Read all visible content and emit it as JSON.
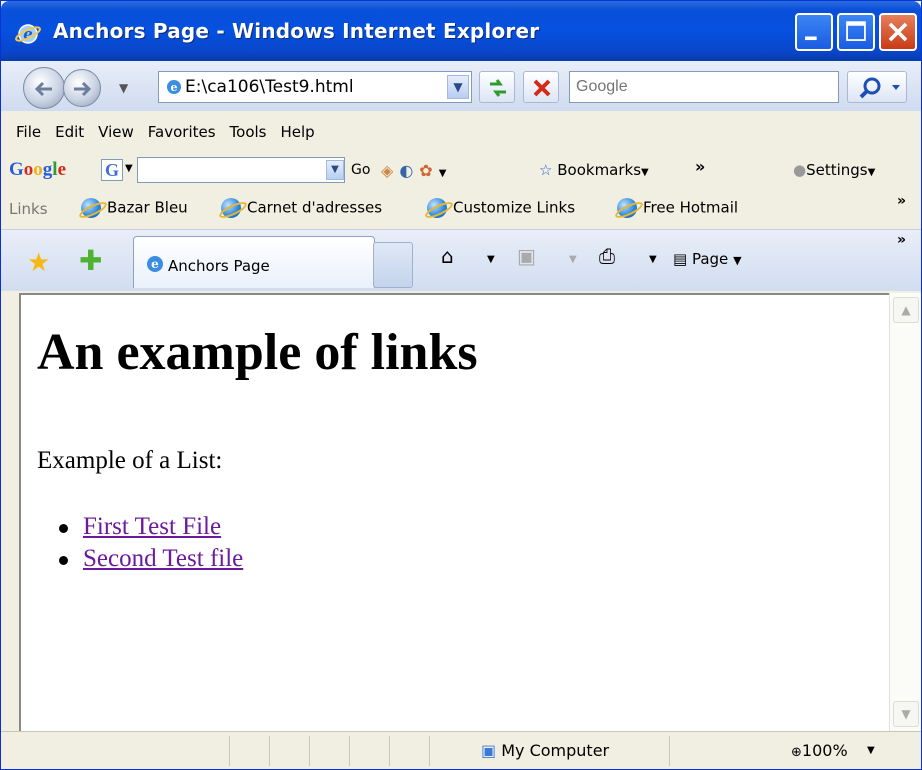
{
  "window": {
    "title": "Anchors Page - Windows Internet Explorer"
  },
  "address_bar": {
    "url": "E:\\ca106\\Test9.html",
    "search_placeholder": "Google"
  },
  "menu": [
    "File",
    "Edit",
    "View",
    "Favorites",
    "Tools",
    "Help"
  ],
  "google_toolbar": {
    "logo": "Google",
    "go_label": "Go",
    "bookmarks_label": "Bookmarks",
    "settings_label": "Settings",
    "more": "»"
  },
  "links_bar": {
    "label": "Links",
    "items": [
      "Bazar Bleu",
      "Carnet d'adresses",
      "Customize Links",
      "Free Hotmail"
    ],
    "more": "»"
  },
  "tabs": {
    "active_label": "Anchors Page",
    "page_menu": "Page",
    "more": "»"
  },
  "page": {
    "heading": "An example of links",
    "paragraph": "Example of a List:",
    "links": [
      "First Test File",
      "Second Test file"
    ]
  },
  "status": {
    "zone": "My Computer",
    "zoom": "100%"
  },
  "colors": {
    "titlebar": "#0551e0",
    "visited_link": "#6a1a9a",
    "chrome": "#f1efe2"
  }
}
